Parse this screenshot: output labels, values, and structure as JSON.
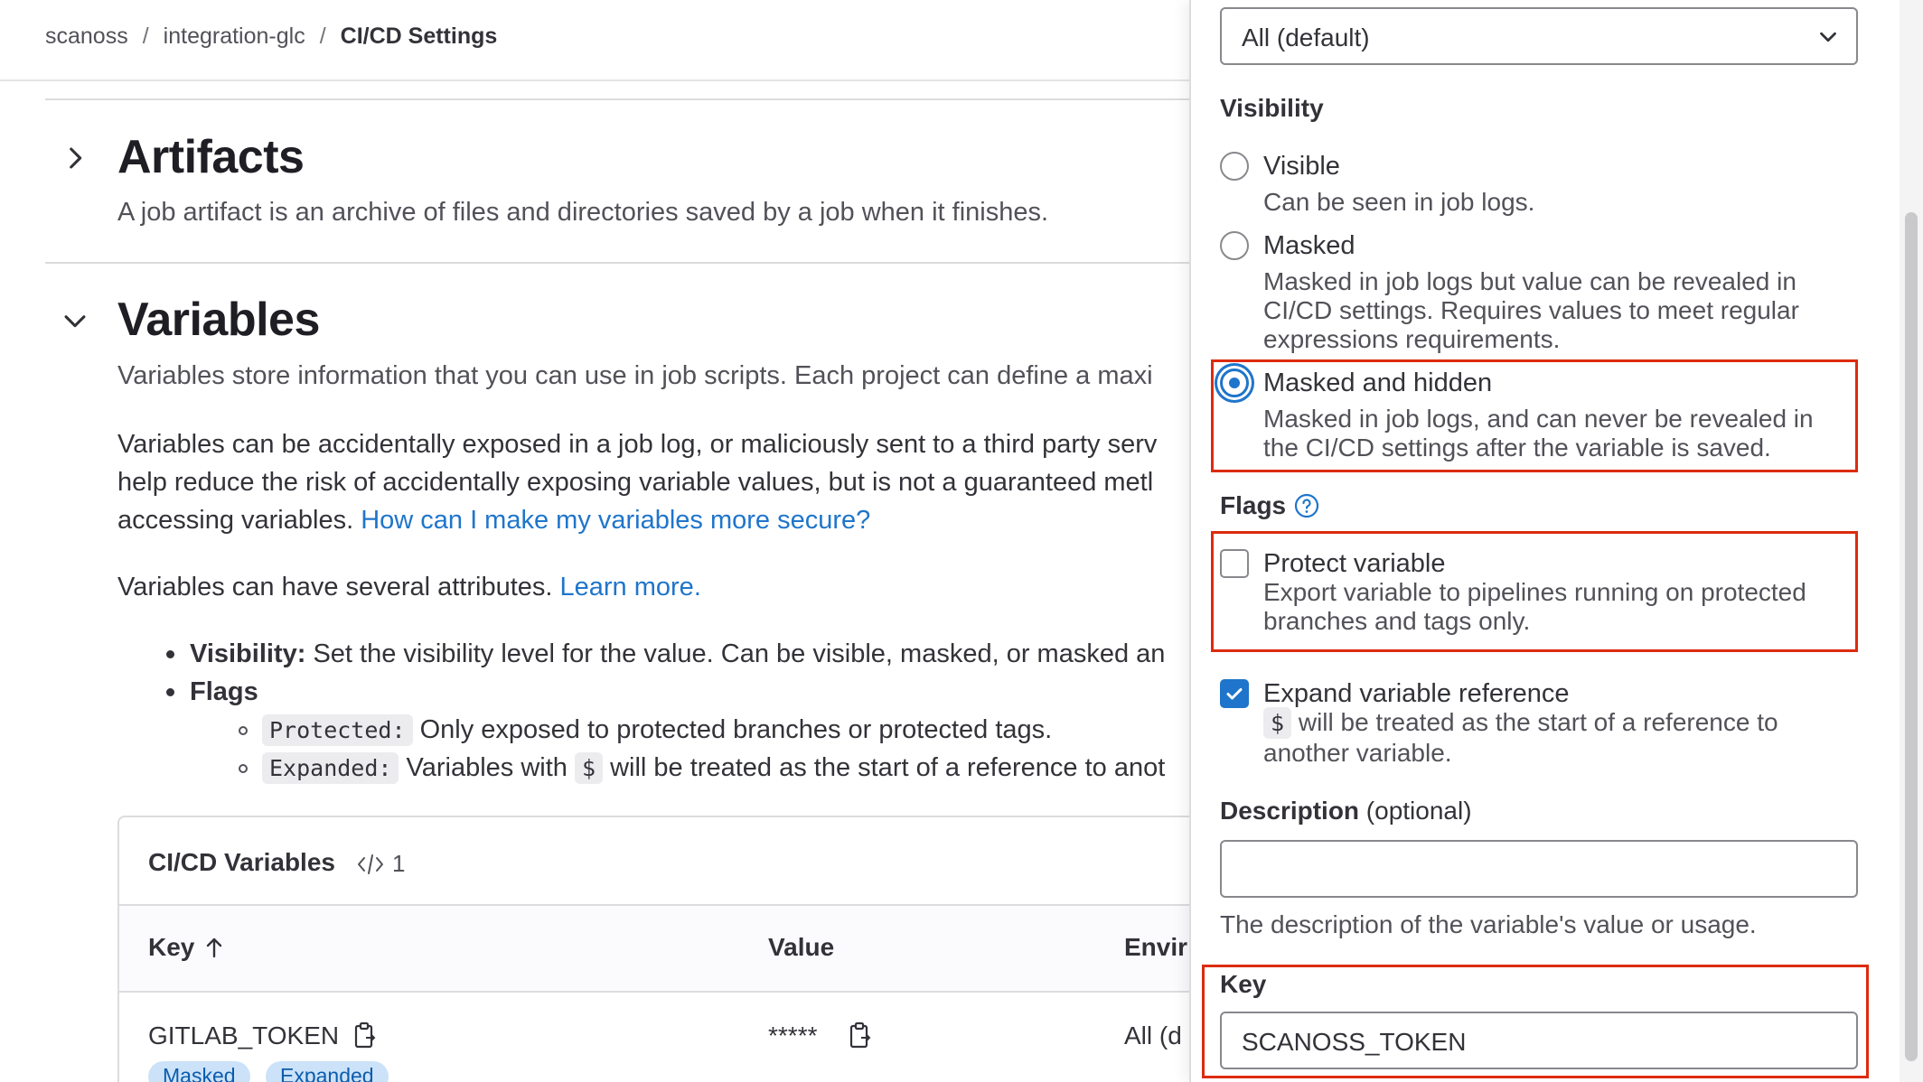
{
  "breadcrumb": {
    "items": [
      "scanoss",
      "integration-glc"
    ],
    "separator": "/",
    "current": "CI/CD Settings"
  },
  "artifacts": {
    "title": "Artifacts",
    "description": "A job artifact is an archive of files and directories saved by a job when it finishes."
  },
  "variables": {
    "title": "Variables",
    "description": "Variables store information that you can use in job scripts. Each project can define a maxi",
    "security_line1": "Variables can be accidentally exposed in a job log, or maliciously sent to a third party serv",
    "security_line2": "help reduce the risk of accidentally exposing variable values, but is not a guaranteed metl",
    "security_line3_prefix": "accessing variables. ",
    "security_link": "How can I make my variables more secure?",
    "attributes_prefix": "Variables can have several attributes. ",
    "attributes_link": "Learn more.",
    "bullets": {
      "visibility_label": "Visibility:",
      "visibility_text": " Set the visibility level for the value. Can be visible, masked, or masked an",
      "flags_label": "Flags",
      "protected_code": "Protected:",
      "protected_text": " Only exposed to protected branches or protected tags.",
      "expanded_code": "Expanded:",
      "expanded_text_1": " Variables with ",
      "expanded_dollar": "$",
      "expanded_text_2": " will be treated as the start of a reference to anot"
    }
  },
  "cicd_table": {
    "title": "CI/CD Variables",
    "count": "1",
    "columns": {
      "key": "Key",
      "value": "Value",
      "environment": "Envir"
    },
    "rows": [
      {
        "key": "GITLAB_TOKEN",
        "value": "*****",
        "environment": "All (d",
        "badges": [
          "Masked",
          "Expanded"
        ]
      }
    ]
  },
  "drawer": {
    "environment_select": "All (default)",
    "visibility_label": "Visibility",
    "visibility_options": [
      {
        "label": "Visible",
        "help": [
          "Can be seen in job logs."
        ],
        "checked": false
      },
      {
        "label": "Masked",
        "help": [
          "Masked in job logs but value can be revealed in",
          "CI/CD settings. Requires values to meet regular",
          "expressions requirements."
        ],
        "checked": false
      },
      {
        "label": "Masked and hidden",
        "help": [
          "Masked in job logs, and can never be revealed in",
          "the CI/CD settings after the variable is saved."
        ],
        "checked": true
      }
    ],
    "flags_label": "Flags",
    "flags": {
      "protect": {
        "label": "Protect variable",
        "help_1": "Export variable to pipelines running on protected",
        "help_2": "branches and tags only.",
        "checked": false
      },
      "expand": {
        "label": "Expand variable reference",
        "help_code": "$",
        "help_1": " will be treated as the start of a reference to",
        "help_2": "another variable.",
        "checked": true
      }
    },
    "description_label": "Description",
    "description_optional": " (optional)",
    "description_value": "",
    "description_help": "The description of the variable's value or usage.",
    "key_label": "Key",
    "key_value": "SCANOSS_TOKEN"
  },
  "colors": {
    "accent": "#1f75cb",
    "highlight": "#dd2b0e",
    "badge_bg": "#cbe2f9",
    "badge_text": "#0b5cad"
  }
}
